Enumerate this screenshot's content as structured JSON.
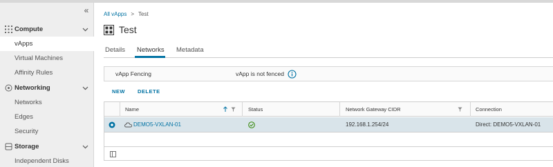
{
  "sidebar": {
    "collapse_icon": "double-chevron-left-icon",
    "sections": [
      {
        "label": "Compute",
        "icon": "grid-icon",
        "items": [
          "vApps",
          "Virtual Machines",
          "Affinity Rules"
        ]
      },
      {
        "label": "Networking",
        "icon": "network-icon",
        "items": [
          "Networks",
          "Edges",
          "Security"
        ]
      },
      {
        "label": "Storage",
        "icon": "storage-icon",
        "items": [
          "Independent Disks"
        ]
      }
    ],
    "active_item": "vApps"
  },
  "breadcrumb": {
    "parent": "All vApps",
    "separator": ">",
    "current": "Test"
  },
  "page": {
    "title": "Test",
    "icon": "vapp-icon"
  },
  "tabs": [
    {
      "label": "Details",
      "active": false
    },
    {
      "label": "Networks",
      "active": true
    },
    {
      "label": "Metadata",
      "active": false
    }
  ],
  "fencing": {
    "label": "vApp Fencing",
    "value": "vApp is not fenced",
    "icon": "info-icon"
  },
  "actions": {
    "new": "NEW",
    "delete": "DELETE"
  },
  "grid": {
    "columns": [
      "Name",
      "Status",
      "Network Gateway CIDR",
      "Connection"
    ],
    "rows": [
      {
        "name": "DEMO5-VXLAN-01",
        "status": "ok",
        "cidr": "192.168.1.254/24",
        "connection": "Direct: DEMO5-VXLAN-01",
        "selected": true
      }
    ]
  },
  "colors": {
    "accent": "#0072a3",
    "selected_row": "#d9e4ea",
    "status_ok": "#2f8400"
  }
}
